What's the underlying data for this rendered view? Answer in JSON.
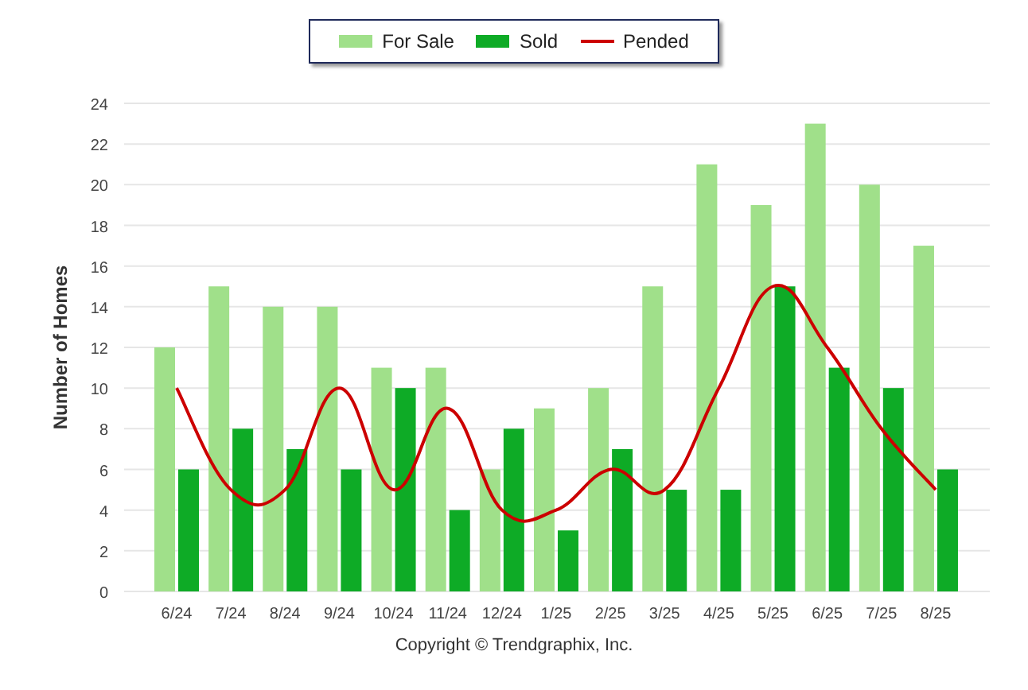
{
  "chart_data": {
    "type": "bar",
    "ylabel": "Number of Homes",
    "categories": [
      "6/24",
      "7/24",
      "8/24",
      "9/24",
      "10/24",
      "11/24",
      "12/24",
      "1/25",
      "2/25",
      "3/25",
      "4/25",
      "5/25",
      "6/25",
      "7/25",
      "8/25"
    ],
    "series": [
      {
        "name": "For Sale",
        "type": "bar",
        "color": "#a0e08a",
        "values": [
          12,
          15,
          14,
          14,
          11,
          11,
          6,
          9,
          10,
          15,
          21,
          19,
          23,
          20,
          17
        ]
      },
      {
        "name": "Sold",
        "type": "bar",
        "color": "#0eab26",
        "values": [
          6,
          8,
          7,
          6,
          10,
          4,
          8,
          3,
          7,
          5,
          5,
          15,
          11,
          10,
          6
        ]
      },
      {
        "name": "Pended",
        "type": "line",
        "color": "#cc0000",
        "values": [
          10,
          5,
          5,
          10,
          5,
          9,
          4,
          4,
          6,
          5,
          10,
          15,
          12,
          8,
          5
        ]
      }
    ],
    "ylim": [
      0,
      24
    ],
    "grid": true,
    "yticks": [
      0,
      2,
      4,
      6,
      8,
      10,
      12,
      14,
      16,
      18,
      20,
      22,
      24
    ]
  },
  "footer": "Copyright © Trendgraphix, Inc."
}
